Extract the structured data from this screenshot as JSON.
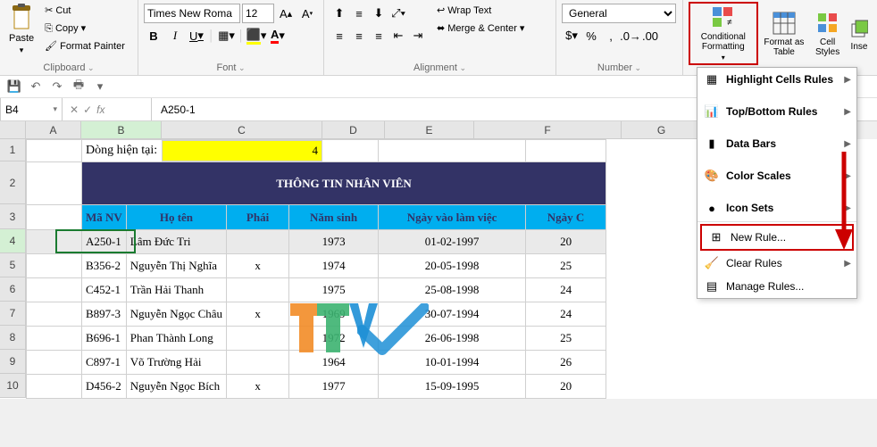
{
  "ribbon": {
    "clipboard": {
      "paste": "Paste",
      "cut": "Cut",
      "copy": "Copy",
      "fp": "Format Painter",
      "label": "Clipboard"
    },
    "font": {
      "name": "Times New Roma",
      "size": "12",
      "bold": "B",
      "italic": "I",
      "underline": "U",
      "label": "Font"
    },
    "align": {
      "wrap": "Wrap Text",
      "merge": "Merge & Center",
      "label": "Alignment"
    },
    "number": {
      "format": "General",
      "label": "Number"
    },
    "styles": {
      "cf": "Conditional Formatting",
      "fmtTable": "Format as Table",
      "cellStyles": "Cell Styles"
    },
    "cells": {
      "ins": "Inse"
    }
  },
  "qat": {},
  "fbar": {
    "ref": "B4",
    "formula": "A250-1"
  },
  "cols": [
    "A",
    "B",
    "C",
    "D",
    "E",
    "F",
    "G"
  ],
  "row1": {
    "label": "Dòng hiện tại:",
    "value": "4"
  },
  "title": "THÔNG TIN NHÂN VIÊN",
  "headers": [
    "Mã NV",
    "Họ tên",
    "Phái",
    "Năm sinh",
    "Ngày vào làm việc",
    "Ngày C"
  ],
  "rows": [
    {
      "id": "A250-1",
      "name": "Lâm Đức Tri",
      "sex": "",
      "year": "1973",
      "date": "01-02-1997",
      "g": "20"
    },
    {
      "id": "B356-2",
      "name": "Nguyễn Thị  Nghĩa",
      "sex": "x",
      "year": "1974",
      "date": "20-05-1998",
      "g": "25"
    },
    {
      "id": "C452-1",
      "name": "Trần Hải Thanh",
      "sex": "",
      "year": "1975",
      "date": "25-08-1998",
      "g": "24"
    },
    {
      "id": "B897-3",
      "name": "Nguyễn Ngọc Châu",
      "sex": "x",
      "year": "1969",
      "date": "30-07-1994",
      "g": "24"
    },
    {
      "id": "B696-1",
      "name": "Phan Thành Long",
      "sex": "",
      "year": "1972",
      "date": "26-06-1998",
      "g": "25"
    },
    {
      "id": "C897-1",
      "name": "Võ Trường Hải",
      "sex": "",
      "year": "1964",
      "date": "10-01-1994",
      "g": "26"
    },
    {
      "id": "D456-2",
      "name": "Nguyễn Ngọc Bích",
      "sex": "x",
      "year": "1977",
      "date": "15-09-1995",
      "g": "20"
    }
  ],
  "dd": {
    "hcr": "Highlight Cells Rules",
    "tbr": "Top/Bottom Rules",
    "db": "Data Bars",
    "cs": "Color Scales",
    "is": "Icon Sets",
    "nr": "New Rule...",
    "cr": "Clear Rules",
    "mr": "Manage Rules..."
  }
}
